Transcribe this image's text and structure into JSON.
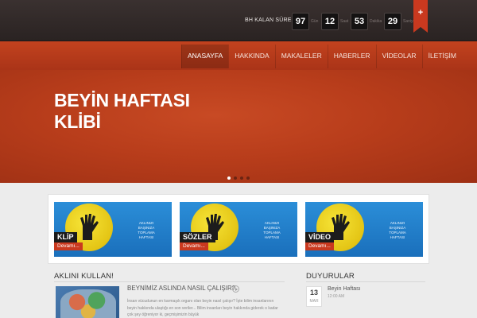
{
  "topbar": {
    "countdown_label": "BH KALAN SÜRE",
    "countdown": [
      {
        "value": "97",
        "unit": "Gün"
      },
      {
        "value": "12",
        "unit": "Saat"
      },
      {
        "value": "53",
        "unit": "Dakika"
      },
      {
        "value": "29",
        "unit": "Saniye"
      }
    ],
    "ribbon_symbol": "+"
  },
  "nav": {
    "items": [
      "ANASAYFA",
      "HAKKINDA",
      "MAKALELER",
      "HABERLER",
      "VİDEOLAR",
      "İLETİŞİM"
    ],
    "active": "ANASAYFA"
  },
  "hero": {
    "title_line1": "BEYİN HAFTASI",
    "title_line2": "KLİBİ",
    "slides": 4,
    "active_slide": 1
  },
  "cards": [
    {
      "label": "KLİP",
      "more": "Devamı...",
      "tag": "AKLINIZI BAŞINIZA TOPLAMA HAFTASI"
    },
    {
      "label": "SÖZLER",
      "more": "Devamı...",
      "tag": "AKLINIZI BAŞINIZA TOPLAMA HAFTASI"
    },
    {
      "label": "VİDEO",
      "more": "Devamı...",
      "tag": "AKLINIZI BAŞINIZA TOPLAMA HAFTASI"
    }
  ],
  "left_section": {
    "title": "AKLINI KULLAN!",
    "article_title": "BEYNİMİZ ASLINDA NASIL ÇALIŞIR?",
    "article_text": "İnsan vücudunun en karmaşık organı olan beyin nasıl çalışır? İşte bilim insanlarının beyin hakkında ulaştığı en son veriler... Bilim insanları beyin hakkında giderek o kadar çok şey öğreniyor ki, geçmişimizin büyük"
  },
  "right_section": {
    "title": "DUYURULAR",
    "news": [
      {
        "day": "13",
        "month": "MAR",
        "title": "Beyin Haftası",
        "time": "12:00 AM"
      }
    ]
  },
  "colors": {
    "accent": "#c9391f",
    "topbar": "#2f2726",
    "hero": "#b83d1b",
    "card_blue": "#1f7ac6"
  }
}
